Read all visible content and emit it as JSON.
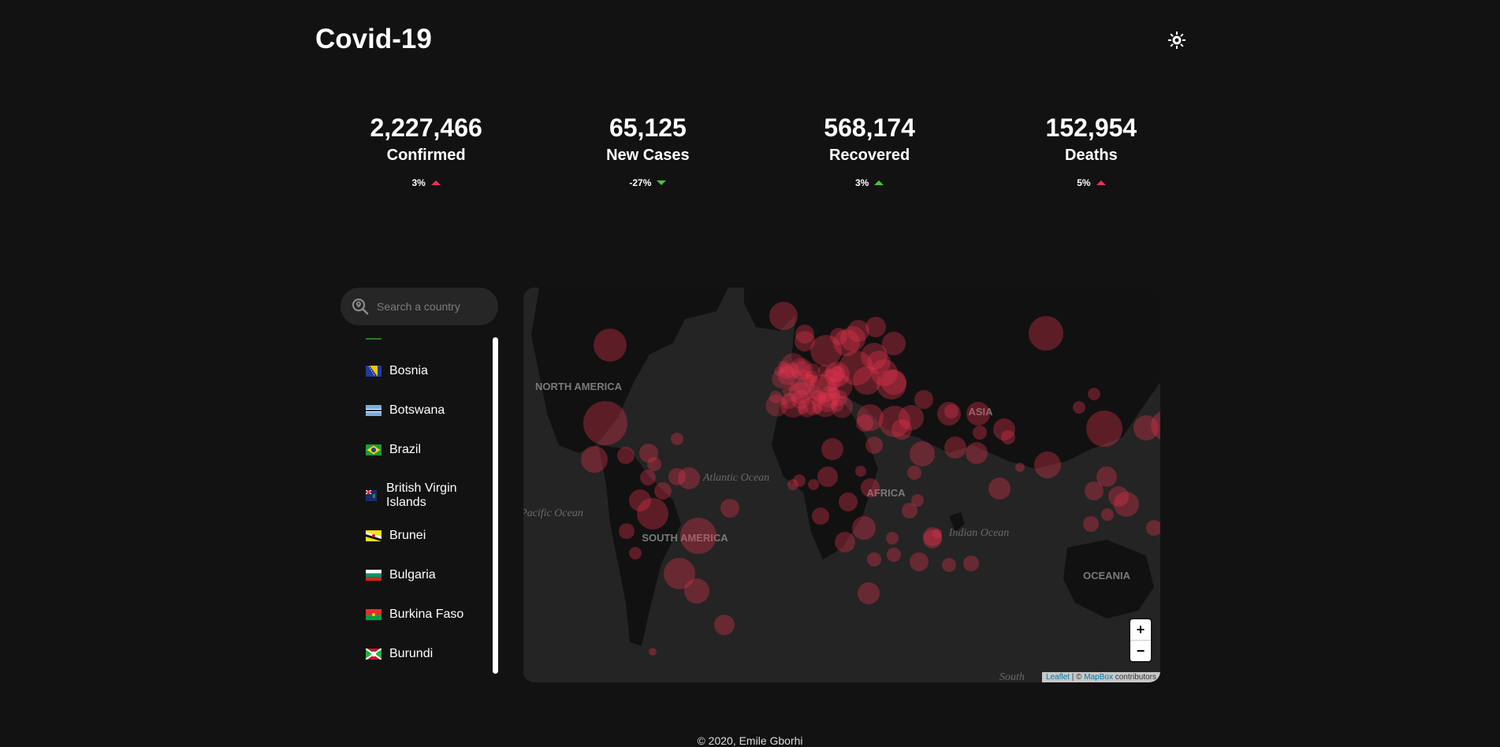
{
  "header": {
    "title": "Covid-19",
    "theme_icon": "sun-icon"
  },
  "stats": [
    {
      "id": "confirmed",
      "value": "2,227,466",
      "label": "Confirmed",
      "change": "3%",
      "direction": "up",
      "color": "#e8344e"
    },
    {
      "id": "new-cases",
      "value": "65,125",
      "label": "New Cases",
      "change": "-27%",
      "direction": "down",
      "color": "#4ac23a"
    },
    {
      "id": "recovered",
      "value": "568,174",
      "label": "Recovered",
      "change": "3%",
      "direction": "up",
      "color": "#4ac23a"
    },
    {
      "id": "deaths",
      "value": "152,954",
      "label": "Deaths",
      "change": "5%",
      "direction": "up",
      "color": "#e8344e"
    }
  ],
  "search": {
    "placeholder": "Search a country"
  },
  "countries": [
    {
      "name": "Bosnia"
    },
    {
      "name": "Botswana"
    },
    {
      "name": "Brazil"
    },
    {
      "name": "British Virgin Islands"
    },
    {
      "name": "Brunei"
    },
    {
      "name": "Bulgaria"
    },
    {
      "name": "Burkina Faso"
    },
    {
      "name": "Burundi"
    }
  ],
  "map": {
    "labels": [
      "NORTH AMERICA",
      "SOUTH AMERICA",
      "AFRICA",
      "ASIA",
      "OCEANIA",
      "Atlantic Ocean",
      "Pacific Ocean",
      "Indian Ocean",
      "South"
    ],
    "bubble_color": "#e8344e",
    "zoom_in": "+",
    "zoom_out": "−",
    "attribution": {
      "leaflet": "Leaflet",
      "separator": " | © ",
      "mapbox": "MapBox",
      "suffix": " contributors"
    }
  },
  "footer": {
    "text": "© 2020, Emile Gborhi"
  }
}
